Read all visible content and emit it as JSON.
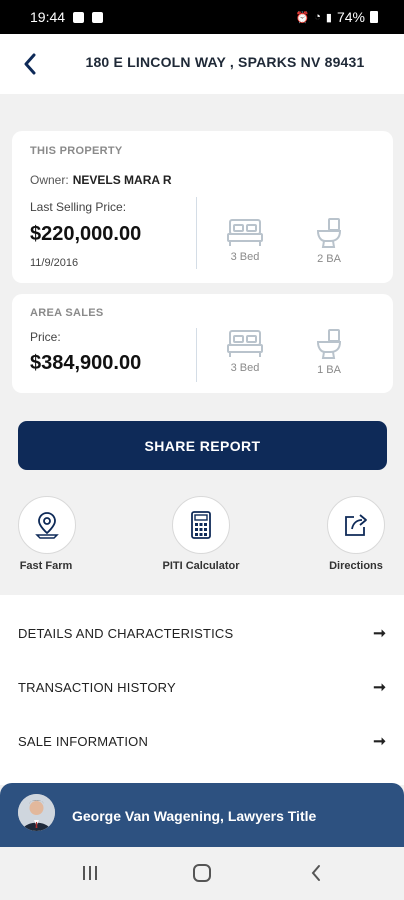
{
  "status_bar": {
    "time": "19:44",
    "battery": "74%"
  },
  "header": {
    "title": "180 E LINCOLN WAY , SPARKS NV 89431"
  },
  "property": {
    "section_label": "THIS PROPERTY",
    "owner_label": "Owner:",
    "owner_name": "NEVELS MARA R",
    "price_label": "Last Selling Price:",
    "price": "$220,000.00",
    "date": "11/9/2016",
    "beds": "3 Bed",
    "baths": "2 BA"
  },
  "area_sales": {
    "section_label": "AREA SALES",
    "price_label": "Price:",
    "price": "$384,900.00",
    "beds": "3 Bed",
    "baths": "1 BA"
  },
  "share_button": "SHARE REPORT",
  "actions": [
    {
      "label": "Fast Farm",
      "icon": "map-pin-icon"
    },
    {
      "label": "PITI Calculator",
      "icon": "calculator-icon"
    },
    {
      "label": "Directions",
      "icon": "directions-icon"
    }
  ],
  "list_items": [
    {
      "label": "DETAILS AND CHARACTERISTICS",
      "arrow": "➞"
    },
    {
      "label": "TRANSACTION HISTORY",
      "arrow": "➞"
    },
    {
      "label": "SALE INFORMATION",
      "arrow": "➞"
    }
  ],
  "agent": {
    "name": "George Van Wagening, Lawyers Title"
  },
  "colors": {
    "primary": "#0e2a58",
    "agent_bar": "#2d5180",
    "background": "#f1f1f1"
  }
}
